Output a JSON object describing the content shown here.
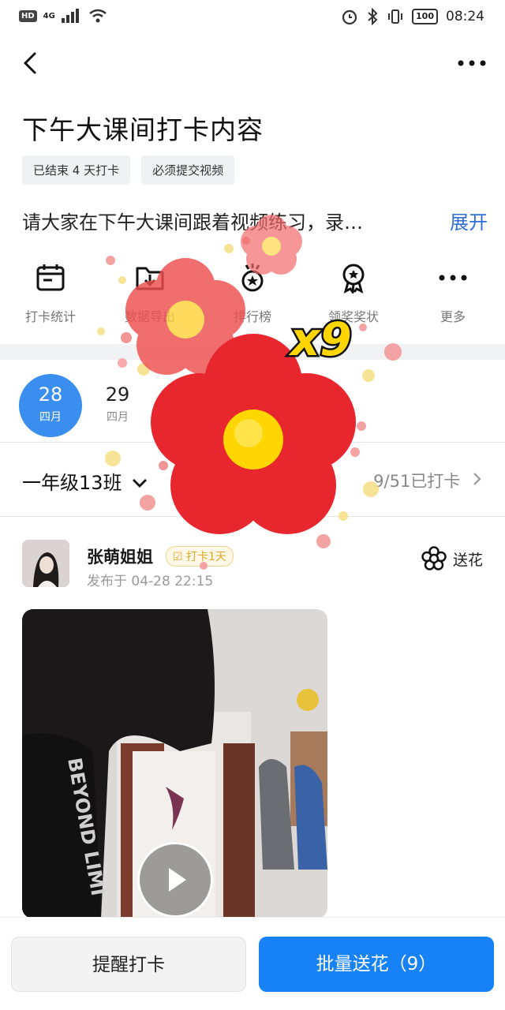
{
  "status": {
    "hd": "HD",
    "signal": "4G",
    "battery": "100",
    "time": "08:24"
  },
  "page": {
    "title": "下午大课间打卡内容",
    "tags": [
      "已结束 4 天打卡",
      "必须提交视频"
    ],
    "description": "请大家在下午大课间跟着视频练习，录…",
    "expand": "展开"
  },
  "actions": [
    {
      "label": "打卡统计",
      "icon": "calendar-stats-icon"
    },
    {
      "label": "数据导出",
      "icon": "folder-download-icon"
    },
    {
      "label": "排行榜",
      "icon": "medal-rank-icon"
    },
    {
      "label": "领奖奖状",
      "icon": "award-ribbon-icon"
    },
    {
      "label": "更多",
      "icon": "more-dots-icon"
    }
  ],
  "dates": [
    {
      "day": "28",
      "month": "四月",
      "active": true
    },
    {
      "day": "29",
      "month": "四月",
      "active": false
    }
  ],
  "class": {
    "name": "一年级13班",
    "count": "9/51已打卡"
  },
  "post": {
    "user": "张萌姐姐",
    "badge": "打卡1天",
    "time": "发布于 04-28 22:15",
    "send_flower": "送花",
    "video_text": "BEYOND LIMI"
  },
  "bottom": {
    "remind": "提醒打卡",
    "batch": "批量送花（9）"
  },
  "overlay": {
    "multiplier": "x9"
  },
  "colors": {
    "accent": "#1682f6",
    "link": "#2d6fd8",
    "flower": "#e8262e",
    "flower_center": "#ffd600"
  }
}
